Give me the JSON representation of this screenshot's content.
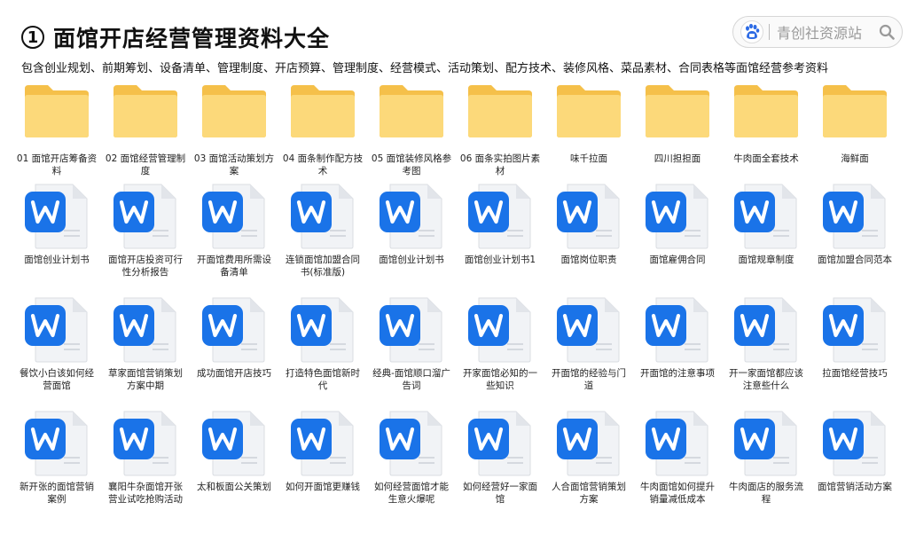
{
  "header": {
    "number_badge": "1",
    "title": "面馆开店经营管理资料大全",
    "subtitle": "包含创业规划、前期筹划、设备清单、管理制度、开店预算、管理制度、经营模式、活动策划、配方技术、装修风格、菜品素材、合同表格等面馆经营参考资料"
  },
  "brand": {
    "text": "青创社资源站",
    "logo_icon": "baidu-paw-icon",
    "search_icon": "search-icon"
  },
  "colors": {
    "folder_light": "#FCD97A",
    "folder_dark": "#F5C04A",
    "word_blue": "#1A73E8",
    "doc_page": "#F1F3F6"
  },
  "rows": [
    {
      "type": "folder",
      "items": [
        "01 面馆开店筹备资料",
        "02 面馆经营管理制度",
        "03 面馆活动策划方案",
        "04 面条制作配方技术",
        "05 面馆装修风格参考图",
        "06 面条实拍图片素材",
        "味千拉面",
        "四川担担面",
        "牛肉面全套技术",
        "海鲜面"
      ]
    },
    {
      "type": "doc",
      "items": [
        "面馆创业计划书",
        "面馆开店投资可行性分析报告",
        "开面馆费用所需设备清单",
        "连锁面馆加盟合同书(标准版)",
        "面馆创业计划书",
        "面馆创业计划书1",
        "面馆岗位职责",
        "面馆雇佣合同",
        "面馆规章制度",
        "面馆加盟合同范本"
      ]
    },
    {
      "type": "doc",
      "items": [
        "餐饮小白该如何经营面馆",
        "草家面馆营销策划方案中期",
        "成功面馆开店技巧",
        "打造特色面馆新时代",
        "经典-面馆顺口溜广告词",
        "开家面馆必知的一些知识",
        "开面馆的经验与门道",
        "开面馆的注意事项",
        "开一家面馆都应该注意些什么",
        "拉面馆经营技巧"
      ]
    },
    {
      "type": "doc",
      "items": [
        "新开张的面馆营销案例",
        "襄阳牛杂面馆开张营业试吃抢购活动",
        "太和板面公关策划",
        "如何开面馆更赚钱",
        "如何经营面馆才能生意火爆呢",
        "如何经营好一家面馆",
        "人合面馆营销策划方案",
        "牛肉面馆如何提升销量减低成本",
        "牛肉面店的服务流程",
        "面馆营销活动方案"
      ]
    }
  ]
}
